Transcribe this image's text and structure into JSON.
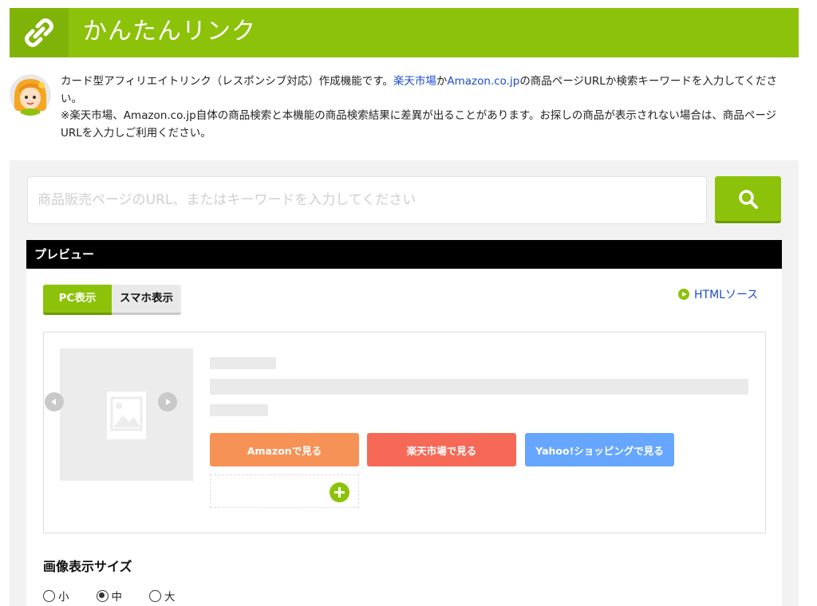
{
  "header": {
    "title": "かんたんリンク",
    "icon": "link-icon"
  },
  "intro": {
    "avatar_icon": "girl-avatar-icon",
    "line1_prefix": "カード型アフィリエイトリンク（レスポンシブ対応）作成機能です。",
    "link_rakuten": "楽天市場",
    "mid": "か",
    "link_amazon": "Amazon.co.jp",
    "line1_suffix": "の商品ページURLか検索キーワードを入力してください。",
    "note": "※楽天市場、Amazon.co.jp自体の商品検索と本機能の商品検索結果に差異が出ることがあります。お探しの商品が表示されない場合は、商品ページURLを入力しご利用ください。"
  },
  "search": {
    "placeholder": "商品販売ページのURL、またはキーワードを入力してください",
    "value": "",
    "button_icon": "search-icon"
  },
  "preview": {
    "title": "プレビュー",
    "tabs": [
      {
        "label": "PC表示",
        "active": true
      },
      {
        "label": "スマホ表示",
        "active": false
      }
    ],
    "html_source_label": "HTMLソース",
    "buttons": {
      "amazon": "Amazonで見る",
      "rakuten": "楽天市場で見る",
      "yahoo": "Yahoo!ショッピングで見る"
    }
  },
  "image_size": {
    "heading": "画像表示サイズ",
    "options": [
      {
        "label": "小",
        "checked": false
      },
      {
        "label": "中",
        "checked": true
      },
      {
        "label": "大",
        "checked": false
      }
    ]
  },
  "colors": {
    "brand_green": "#8cc20a",
    "amazon": "#f79256",
    "rakuten": "#f76957",
    "yahoo": "#66a6ff",
    "link": "#1d4ccf"
  }
}
